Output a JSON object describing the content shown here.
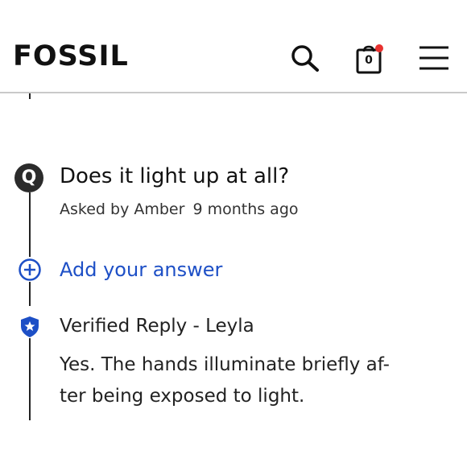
{
  "header": {
    "brand": "FOSSIL",
    "cart_count": "0"
  },
  "question": {
    "badge": "Q",
    "text": "Does it light up at all?",
    "asked_by": "Asked by Amber",
    "time_ago": "9 months ago"
  },
  "add_answer_label": "Add your answer",
  "reply": {
    "title": "Verified Reply - Leyla",
    "lines": [
      "Yes. The hands illuminate briefly af-",
      "ter being exposed to light."
    ]
  },
  "colors": {
    "accent_blue": "#1d4fc6",
    "cart_dot": "#e8312f",
    "badge_dark": "#2b2b2b"
  },
  "icons": {
    "search": "search-icon",
    "cart": "shopping-bag-icon",
    "menu": "hamburger-menu-icon",
    "add": "add-circle-icon",
    "verified": "verified-shield-icon"
  }
}
